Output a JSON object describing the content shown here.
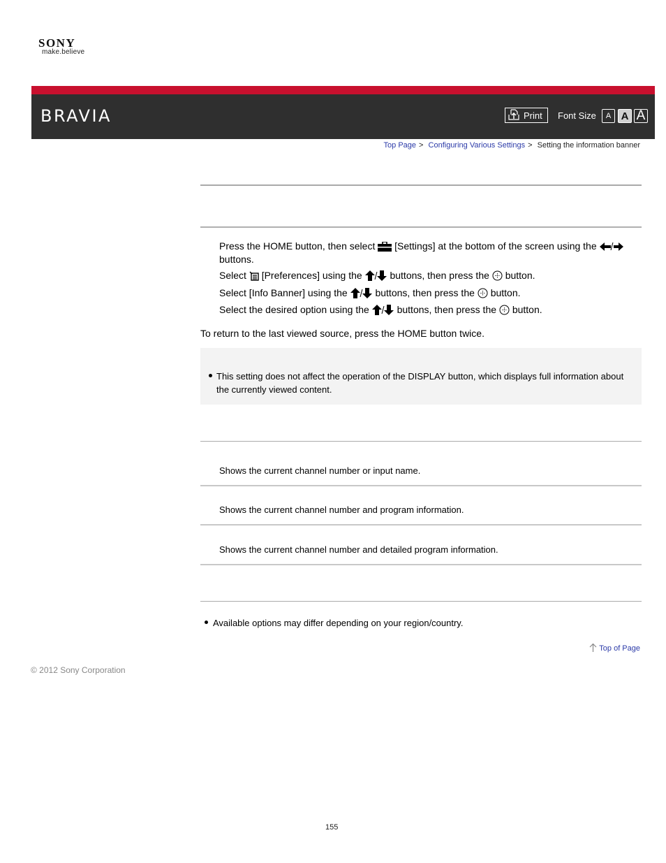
{
  "brand": {
    "logo": "SONY",
    "tagline": "make.believe",
    "product": "BRAVIA",
    "accent_color": "#c8102e",
    "header_color": "#2f2f2f"
  },
  "toolbar": {
    "print_label": "Print",
    "font_size_label": "Font Size",
    "font_sizes": [
      "A",
      "A",
      "A"
    ],
    "selected_font_size": "medium"
  },
  "breadcrumb": {
    "items": [
      "Top Page",
      "Configuring Various Settings"
    ],
    "current": "Setting the information banner",
    "separator": ">"
  },
  "steps": [
    {
      "parts": [
        "Press the HOME button, then select ",
        "[Settings] at the bottom of the screen using the ",
        "buttons."
      ],
      "icons": [
        "toolbox-icon",
        "left-right-arrow-icon"
      ]
    },
    {
      "parts": [
        "Select ",
        "[Preferences] using the ",
        "buttons, then press the ",
        "button."
      ],
      "icons": [
        "preferences-icon",
        "up-down-arrow-icon",
        "enter-button-icon"
      ]
    },
    {
      "parts": [
        "Select [Info Banner] using the ",
        "buttons, then press the ",
        "button."
      ],
      "icons": [
        "up-down-arrow-icon",
        "enter-button-icon"
      ]
    },
    {
      "parts": [
        "Select the desired option using the ",
        "buttons, then press the ",
        "button."
      ],
      "icons": [
        "up-down-arrow-icon",
        "enter-button-icon"
      ]
    }
  ],
  "return_text": "To return to the last viewed source, press the HOME button twice.",
  "note": "This setting does not affect the operation of the DISPLAY button, which displays full information about the currently viewed content.",
  "options": [
    {
      "description": "Shows the current channel number or input name."
    },
    {
      "description": "Shows the current channel number and program information."
    },
    {
      "description": "Shows the current channel number and detailed program information."
    }
  ],
  "extra_note": "Available options may differ depending on your region/country.",
  "top_of_page": "Top of Page",
  "copyright": "© 2012 Sony Corporation",
  "page_number": "155"
}
